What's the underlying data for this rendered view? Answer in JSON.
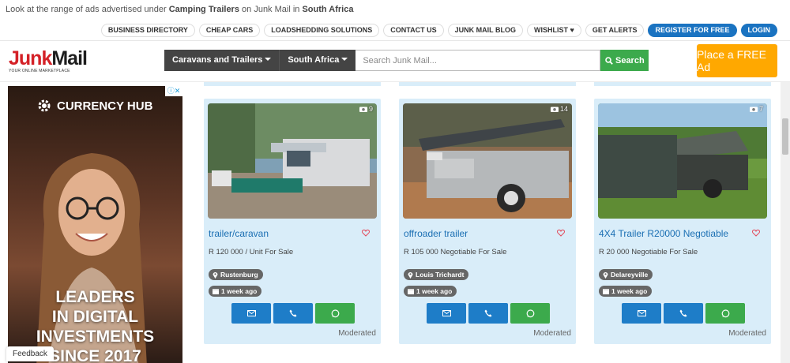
{
  "topbar": {
    "prefix": "Look at the range of ads advertised under",
    "category": "Camping Trailers",
    "middle": "on Junk Mail in",
    "region": "South Africa"
  },
  "nav": [
    {
      "label": "BUSINESS DIRECTORY"
    },
    {
      "label": "CHEAP CARS"
    },
    {
      "label": "LOADSHEDDING SOLUTIONS"
    },
    {
      "label": "CONTACT US"
    },
    {
      "label": "JUNK MAIL BLOG"
    },
    {
      "label": "WISHLIST ♥"
    },
    {
      "label": "GET ALERTS"
    }
  ],
  "register_label": "REGISTER FOR FREE",
  "login_label": "LOGIN",
  "logo": {
    "junk": "Junk",
    "mail": "Mail",
    "tagline": "YOUR ONLINE MARKETPLACE"
  },
  "search": {
    "category": "Caravans and Trailers",
    "region": "South Africa",
    "placeholder": "Search Junk Mail...",
    "button": "Search"
  },
  "place_ad": "Place a FREE Ad",
  "ad": {
    "brand": "CURRENCY HUB",
    "headline_1": "LEADERS",
    "headline_2": "IN DIGITAL",
    "headline_3": "INVESTMENTS",
    "headline_4": "SINCE 2017"
  },
  "feedback": "Feedback",
  "listings": [
    {
      "title": "trailer/caravan",
      "price": "R 120 000 / Unit For Sale",
      "location": "Rustenburg",
      "age": "1 week ago",
      "photos": "9",
      "status": "Moderated"
    },
    {
      "title": "offroader trailer",
      "price": "R 105 000 Negotiable For Sale",
      "location": "Louis Trichardt",
      "age": "1 week ago",
      "photos": "14",
      "status": "Moderated"
    },
    {
      "title": "4X4 Trailer R20000 Negotiable",
      "price": "R 20 000 Negotiable For Sale",
      "location": "Delareyville",
      "age": "1 week ago",
      "photos": "7",
      "status": "Moderated"
    }
  ],
  "colors": {
    "brand_red": "#d42127",
    "accent_blue": "#1a73c1",
    "green": "#3caa4c",
    "orange": "#ffa800",
    "card_bg": "#d9edf9"
  }
}
